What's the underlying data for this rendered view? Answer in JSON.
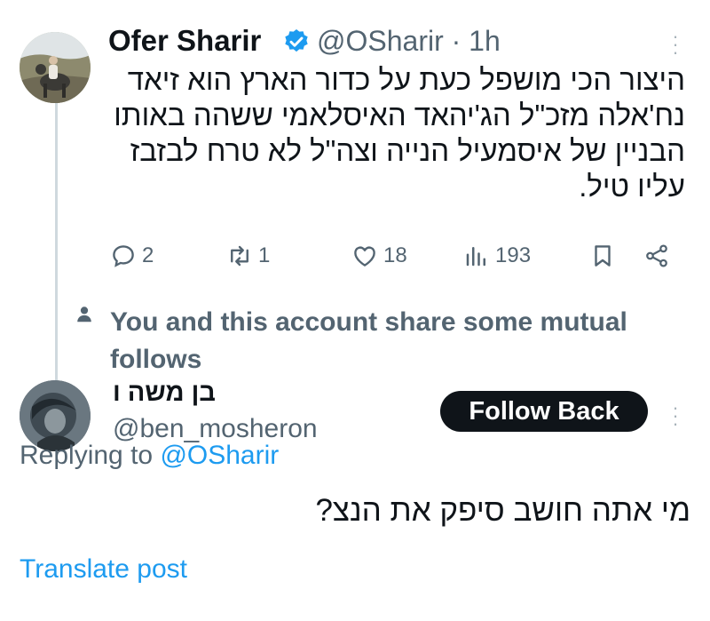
{
  "tweet": {
    "author_name": "Ofer Sharir",
    "author_handle": "@OSharir",
    "separator": "·",
    "time": "1h",
    "text": "היצור הכי מושפל כעת על כדור הארץ הוא זיאד נח'אלה מזכ\"ל הג'יהאד האיסלאמי ששהה באותו הבניין של איסמעיל הנייה וצה\"ל לא טרח לבזבז עליו טיל.",
    "actions": {
      "replies": "2",
      "reposts": "1",
      "likes": "18",
      "views": "193"
    }
  },
  "mutual_notice": "You and this account share some mutual follows",
  "reply": {
    "author_name": "בן משה ו",
    "author_handle": "@ben_mosheron",
    "follow_button": "Follow Back",
    "replying_prefix": "Replying to",
    "replying_to": "@OSharir",
    "text": "מי אתה חושב סיפק את הנצ?",
    "translate_link": "Translate post"
  },
  "colors": {
    "text": "#0f1419",
    "secondary": "#536471",
    "link": "#1d9bf0",
    "verified": "#1d9bf0",
    "button_bg": "#0f1419"
  },
  "icons": [
    "verified-badge-icon",
    "more-icon",
    "reply-icon",
    "repost-icon",
    "like-icon",
    "views-icon",
    "bookmark-icon",
    "share-icon",
    "person-icon"
  ]
}
